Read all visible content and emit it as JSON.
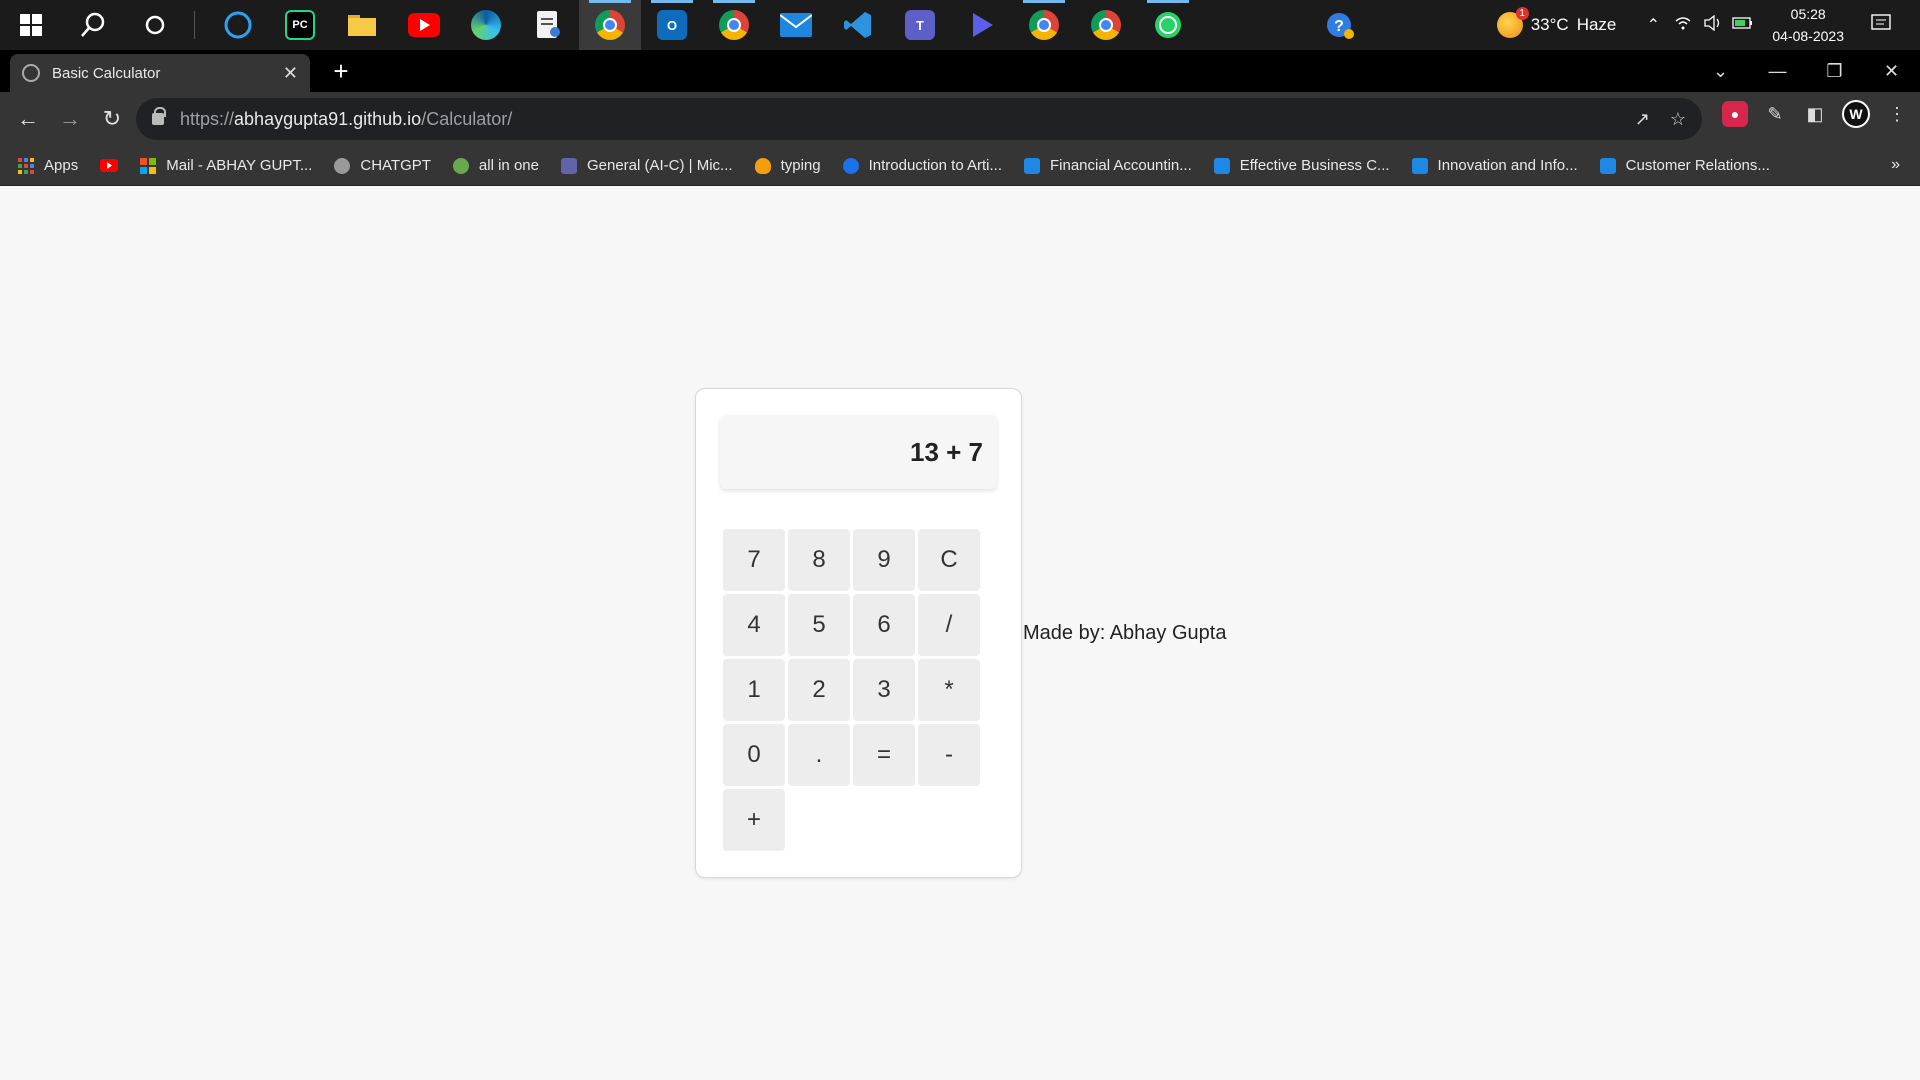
{
  "taskbar": {
    "pinned": [
      {
        "name": "start",
        "icon": "windows-icon"
      },
      {
        "name": "search",
        "icon": "search-icon"
      },
      {
        "name": "task-view",
        "icon": "task-view-icon"
      },
      {
        "name": "cortana",
        "icon": "cortana-icon"
      },
      {
        "name": "pycharm",
        "icon": "pycharm-icon",
        "label": "PC"
      },
      {
        "name": "file-explorer",
        "icon": "folder-icon"
      },
      {
        "name": "youtube",
        "icon": "youtube-icon"
      },
      {
        "name": "edge",
        "icon": "edge-icon"
      },
      {
        "name": "notes",
        "icon": "document-icon"
      },
      {
        "name": "chrome-profile-w",
        "icon": "chrome-icon"
      },
      {
        "name": "outlook",
        "icon": "outlook-icon"
      },
      {
        "name": "chrome-2",
        "icon": "chrome-icon"
      },
      {
        "name": "mail",
        "icon": "mail-icon"
      },
      {
        "name": "vscode",
        "icon": "vscode-icon"
      },
      {
        "name": "teams",
        "icon": "teams-icon"
      },
      {
        "name": "power-automate",
        "icon": "power-automate-icon"
      },
      {
        "name": "chrome-3",
        "icon": "chrome-icon"
      },
      {
        "name": "chrome-4",
        "icon": "chrome-icon"
      },
      {
        "name": "whatsapp",
        "icon": "whatsapp-icon"
      }
    ],
    "weather": {
      "temp": "33°C",
      "condition": "Haze",
      "badge": "1"
    },
    "clock": {
      "time": "05:28",
      "date": "04-08-2023"
    }
  },
  "browser": {
    "tab_title": "Basic Calculator",
    "url_prefix": "https://",
    "url_host": "abhaygupta91.github.io",
    "url_path": "/Calculator/",
    "bookmarks": [
      {
        "label": "Apps",
        "color": "#ea4335"
      },
      {
        "label": "",
        "color": "#ff0000"
      },
      {
        "label": "Mail - ABHAY GUPT...",
        "color": "#f25022"
      },
      {
        "label": "CHATGPT",
        "color": "#9a9a9a"
      },
      {
        "label": "all in one",
        "color": "#6aa84f"
      },
      {
        "label": "General (AI-C) | Mic...",
        "color": "#6264a7"
      },
      {
        "label": "typing",
        "color": "#f59e0b"
      },
      {
        "label": "Introduction to Arti...",
        "color": "#1a73e8"
      },
      {
        "label": "Financial Accountin...",
        "color": "#1e88e5"
      },
      {
        "label": "Effective Business C...",
        "color": "#1e88e5"
      },
      {
        "label": "Innovation and Info...",
        "color": "#1e88e5"
      },
      {
        "label": "Customer Relations...",
        "color": "#1e88e5"
      }
    ],
    "avatar_letter": "W"
  },
  "calculator": {
    "display": "13 + 7",
    "keys": [
      "7",
      "8",
      "9",
      "C",
      "4",
      "5",
      "6",
      "/",
      "1",
      "2",
      "3",
      "*",
      "0",
      ".",
      "=",
      "-",
      "+"
    ]
  },
  "credit": "Made by: Abhay Gupta"
}
